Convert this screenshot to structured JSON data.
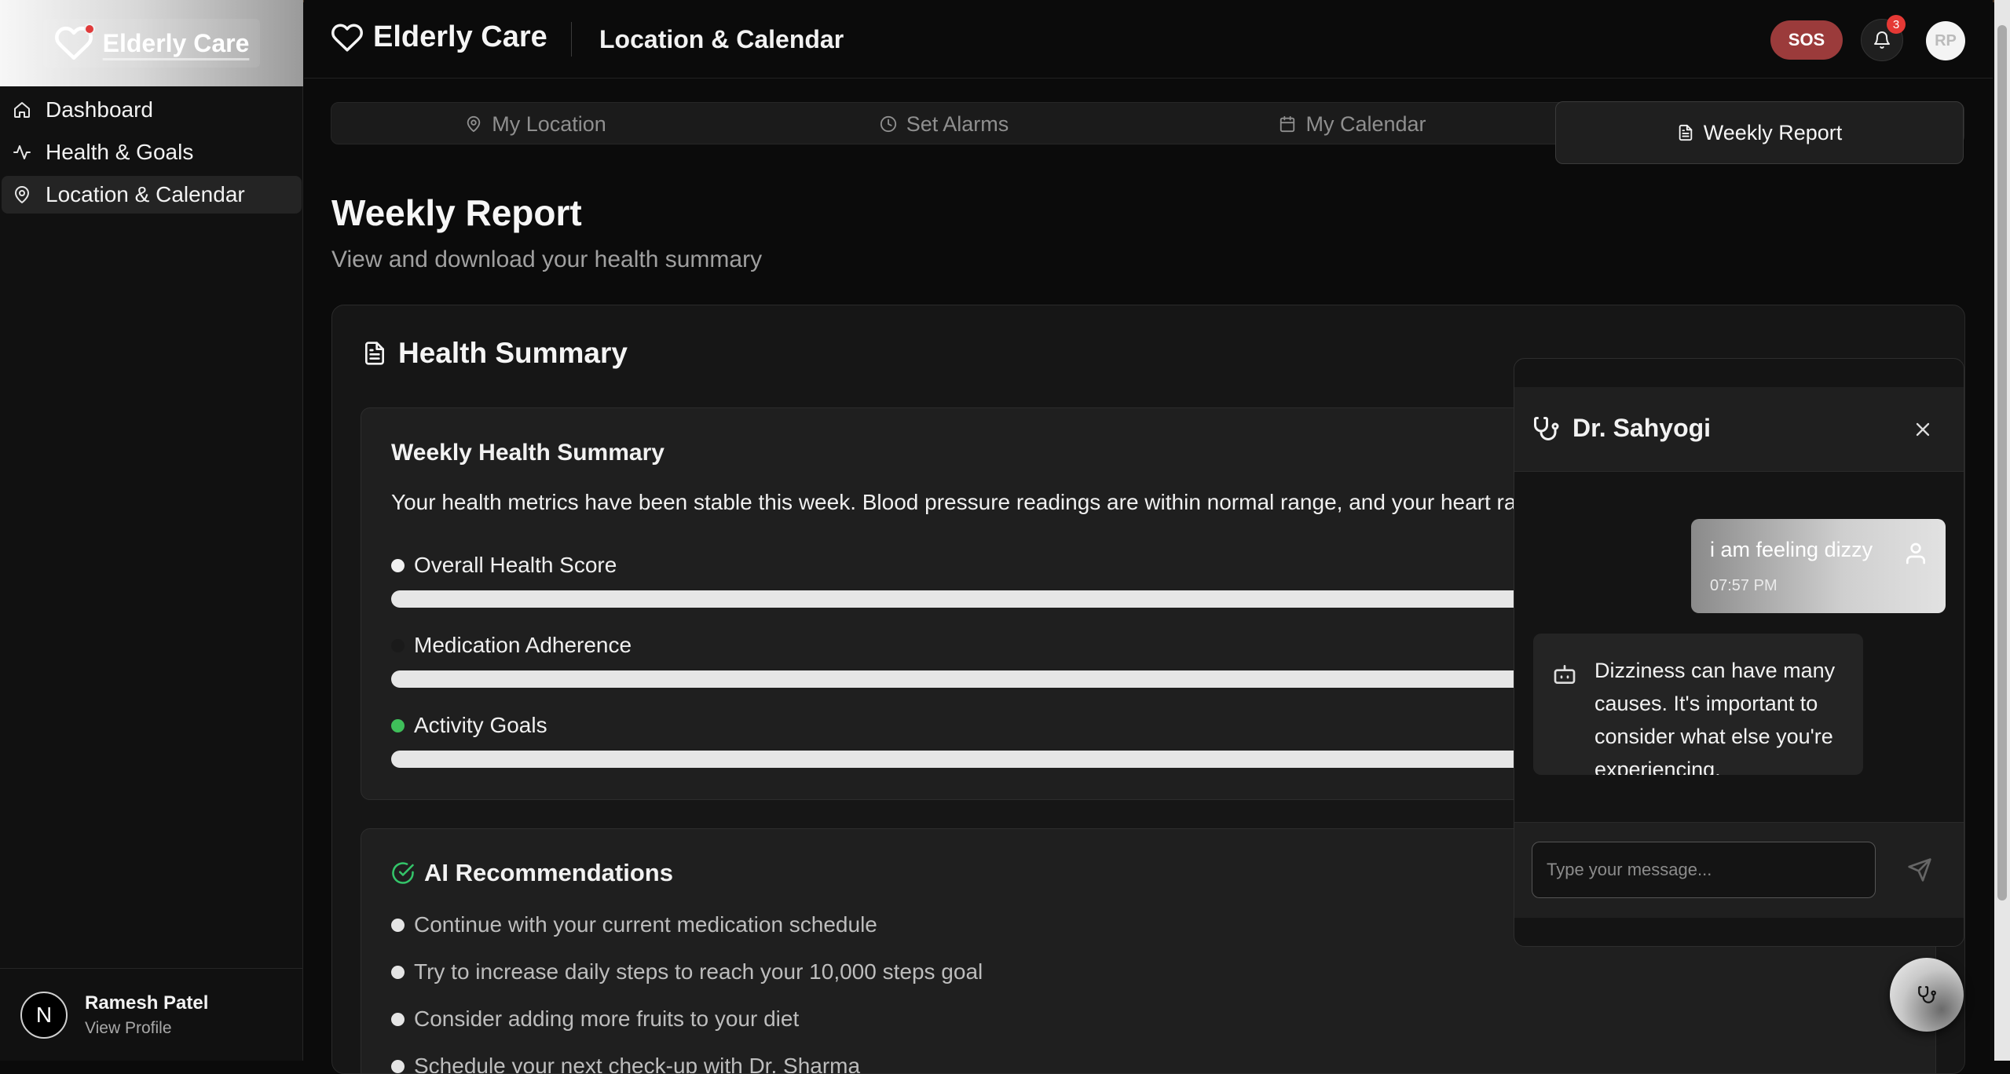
{
  "app": {
    "logo_text": "Elderly Care"
  },
  "sidebar": {
    "items": [
      {
        "label": "Dashboard",
        "icon": "home-icon"
      },
      {
        "label": "Health & Goals",
        "icon": "activity-icon"
      },
      {
        "label": "Location & Calendar",
        "icon": "map-pin-icon",
        "active": true
      }
    ],
    "profile": {
      "initial": "N",
      "name": "Ramesh Patel",
      "link": "View Profile"
    }
  },
  "header": {
    "brand": "Elderly Care",
    "page": "Location & Calendar",
    "sos_label": "SOS",
    "notification_count": "3",
    "avatar_initials": "RP"
  },
  "tabs": [
    {
      "label": "My Location",
      "icon": "map-pin-icon"
    },
    {
      "label": "Set Alarms",
      "icon": "clock-icon"
    },
    {
      "label": "My Calendar",
      "icon": "calendar-icon"
    },
    {
      "label": "Weekly Report",
      "icon": "file-text-icon",
      "active": true
    }
  ],
  "page": {
    "title": "Weekly Report",
    "subtitle": "View and download your health summary"
  },
  "health_summary": {
    "title": "Health Summary",
    "summary_title": "Weekly Health Summary",
    "summary_text": "Your health metrics have been stable this week. Blood pressure readings are within normal range, and your heart rate",
    "metrics": [
      {
        "label": "Overall Health Score",
        "dot_color": "#f0f0f0"
      },
      {
        "label": "Medication Adherence",
        "dot_color": "#1a1a1a"
      },
      {
        "label": "Activity Goals",
        "dot_color": "#3fbf5a"
      }
    ]
  },
  "recommendations": {
    "title": "AI Recommendations",
    "items": [
      "Continue with your current medication schedule",
      "Try to increase daily steps to reach your 10,000 steps goal",
      "Consider adding more fruits to your diet",
      "Schedule your next check-up with Dr. Sharma"
    ]
  },
  "chat": {
    "title": "Dr. Sahyogi",
    "user_message": "i am feeling dizzy",
    "user_time": "07:57 PM",
    "bot_message": "Dizziness can have many causes. It's important to consider what else you're experiencing.",
    "input_placeholder": "Type your message..."
  },
  "colors": {
    "sos": "#9b3b3b",
    "badge": "#e53935",
    "success": "#34c56a"
  }
}
